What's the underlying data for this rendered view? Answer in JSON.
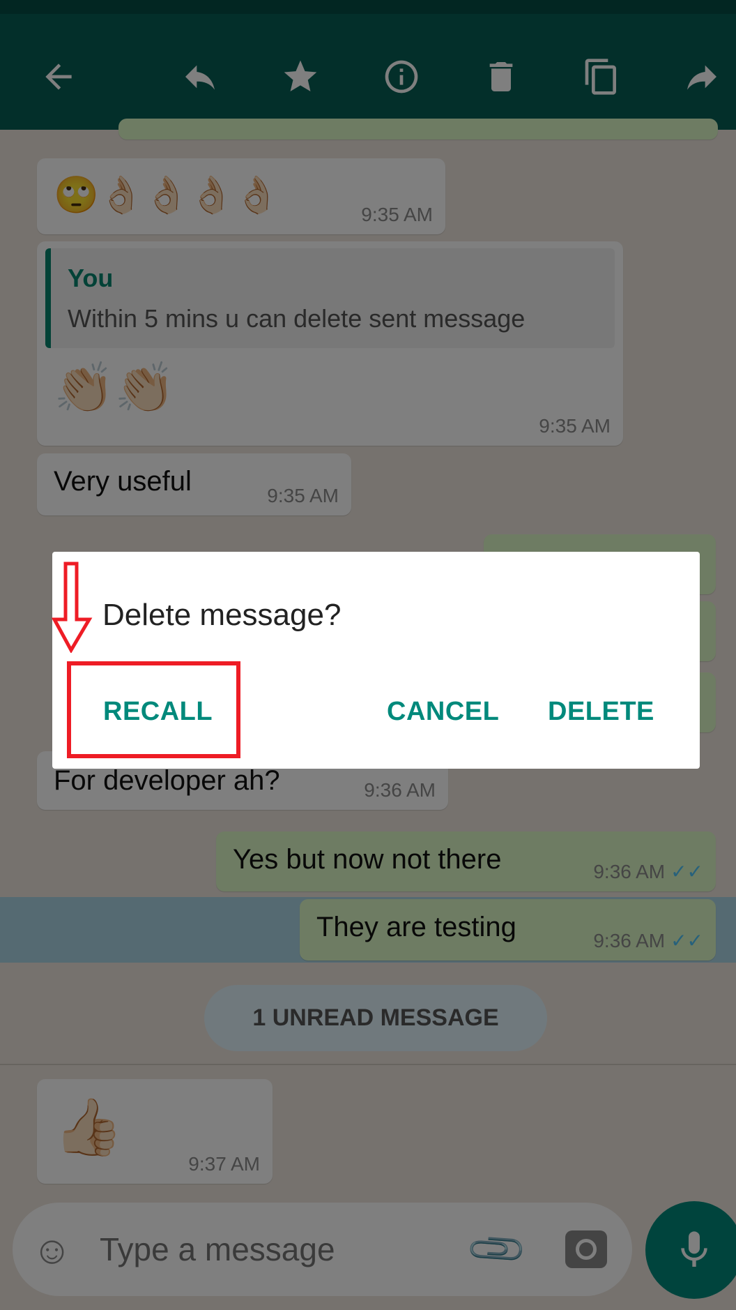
{
  "header": {
    "icons": [
      "back-arrow-icon",
      "reply-icon",
      "star-icon",
      "info-icon",
      "delete-icon",
      "copy-icon",
      "forward-icon"
    ]
  },
  "messages": [
    {
      "emoji": "🙄👌🏻👌🏻👌🏻👌🏻",
      "time": "9:35 AM"
    },
    {
      "quote_author": "You",
      "quote_text": "Within 5 mins u can delete sent message",
      "emoji": "👏🏻👏🏻",
      "time": "9:35 AM"
    },
    {
      "text": "Very useful",
      "time": "9:35 AM"
    },
    {
      "text": "For developer ah?",
      "time": "9:36 AM"
    },
    {
      "text": "Yes but now not there",
      "time": "9:36 AM",
      "ticks": "✓✓"
    },
    {
      "text": "They are testing",
      "time": "9:36 AM",
      "ticks": "✓✓"
    },
    {
      "emoji": "👍🏻",
      "time": "9:37 AM"
    }
  ],
  "unread_label": "1 UNREAD MESSAGE",
  "input": {
    "placeholder": "Type a message"
  },
  "dialog": {
    "title": "Delete message?",
    "recall": "RECALL",
    "cancel": "CANCEL",
    "delete": "DELETE"
  },
  "colors": {
    "header": "#075e54",
    "accent": "#00897b",
    "annotation": "#ee1c25",
    "outgoing": "#dcf8c6"
  }
}
